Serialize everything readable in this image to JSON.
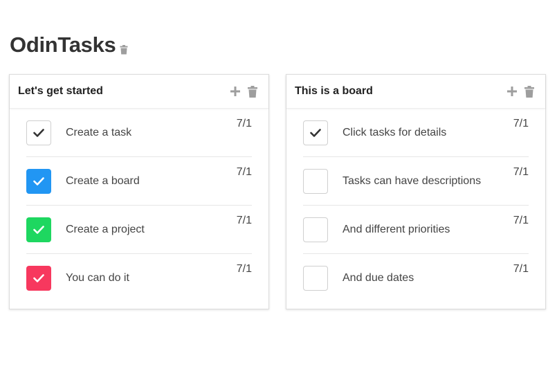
{
  "app": {
    "title": "OdinTasks"
  },
  "colors": {
    "blue": "#2196f3",
    "green": "#1ed760",
    "red": "#f7385e",
    "icon_gray": "#9e9e9e"
  },
  "boards": [
    {
      "title": "Let's get started",
      "tasks": [
        {
          "label": "Create a task",
          "date": "7/1",
          "checked": true,
          "color": "none"
        },
        {
          "label": "Create a board",
          "date": "7/1",
          "checked": true,
          "color": "blue"
        },
        {
          "label": "Create a project",
          "date": "7/1",
          "checked": true,
          "color": "green"
        },
        {
          "label": "You can do it",
          "date": "7/1",
          "checked": true,
          "color": "red"
        }
      ]
    },
    {
      "title": "This is a board",
      "tasks": [
        {
          "label": "Click tasks for details",
          "date": "7/1",
          "checked": true,
          "color": "none"
        },
        {
          "label": "Tasks can have descriptions",
          "date": "7/1",
          "checked": false,
          "color": "none"
        },
        {
          "label": "And different priorities",
          "date": "7/1",
          "checked": false,
          "color": "none"
        },
        {
          "label": "And due dates",
          "date": "7/1",
          "checked": false,
          "color": "none"
        }
      ]
    }
  ]
}
